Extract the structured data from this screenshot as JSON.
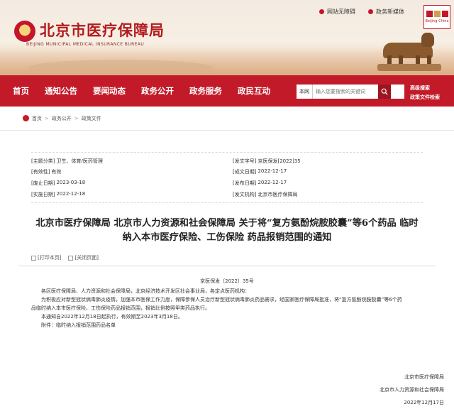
{
  "header": {
    "top_links": {
      "accessibility": "网站无障碍",
      "mobile": "政务新媒体"
    },
    "logo": {
      "title": "北京市医疗保障局",
      "subtitle_en": "BEIJING MUNICIPAL MEDICAL INSURANCE BUREAU"
    },
    "capital_logo_caption": "Beijing-China"
  },
  "nav": {
    "items": [
      "首页",
      "通知公告",
      "要闻动态",
      "政务公开",
      "政务服务",
      "政民互动"
    ],
    "search": {
      "scope": "本网",
      "placeholder": "输入您要搜索的关键词"
    },
    "side_links": [
      "高级搜索",
      "政策文件检索"
    ]
  },
  "breadcrumb": [
    "首页",
    "政务公开",
    "政策文件"
  ],
  "meta": {
    "rows": [
      {
        "left_key": "[主题分类]",
        "left_val": "卫生、体育/医药管理",
        "right_key": "[发文字号]",
        "right_val": "京医保发[2022]35"
      },
      {
        "left_key": "[有效性]",
        "left_val": "有效",
        "right_key": "[成文日期]",
        "right_val": "2022-12-17"
      },
      {
        "left_key": "[废止日期]",
        "left_val": "2023-03-18",
        "right_key": "[发布日期]",
        "right_val": "2022-12-17"
      },
      {
        "left_key": "[实施日期]",
        "left_val": "2022-12-18",
        "right_key": "[发文机构]",
        "right_val": "北京市医疗保障局"
      }
    ]
  },
  "document": {
    "title_line1": "北京市医疗保障局 北京市人力资源和社会保障局 关于将“复方氨酚烷胺胶囊”等6个药品 临时",
    "title_line2": "纳入本市医疗保险、工伤保险 药品报销范围的通知",
    "print_label": "[打印本页]",
    "close_label": "[关闭页面]",
    "doc_number": "京医保发〔2022〕35号",
    "addressee": "各区医疗保障局、人力资源和社会保障局，北京经济技术开发区社会事业局，各定点医药机构：",
    "para1_line1": "为积极应对新型冠状病毒肺炎疫情，加强本市医保工作力度，保障参保人员治疗新型冠状病毒肺炎药品需求，经国家医疗保障局批准，将“复方氨酚烷胺胶囊”等6个药",
    "para1_line2": "品临时纳入本市医疗保险、工伤保险药品报销范围，报销比例按照甲类药品执行。",
    "para2": "本通知自2022年12月18日起执行，有效期至2023年3月18日。",
    "attachment": "附件：临时纳入报销范围药品名单",
    "signer1": "北京市医疗保障局",
    "signer2": "北京市人力资源和社会保障局",
    "date": "2022年12月17日"
  },
  "colors": {
    "brand_red": "#c21a28",
    "title_red": "#b31b1e"
  }
}
